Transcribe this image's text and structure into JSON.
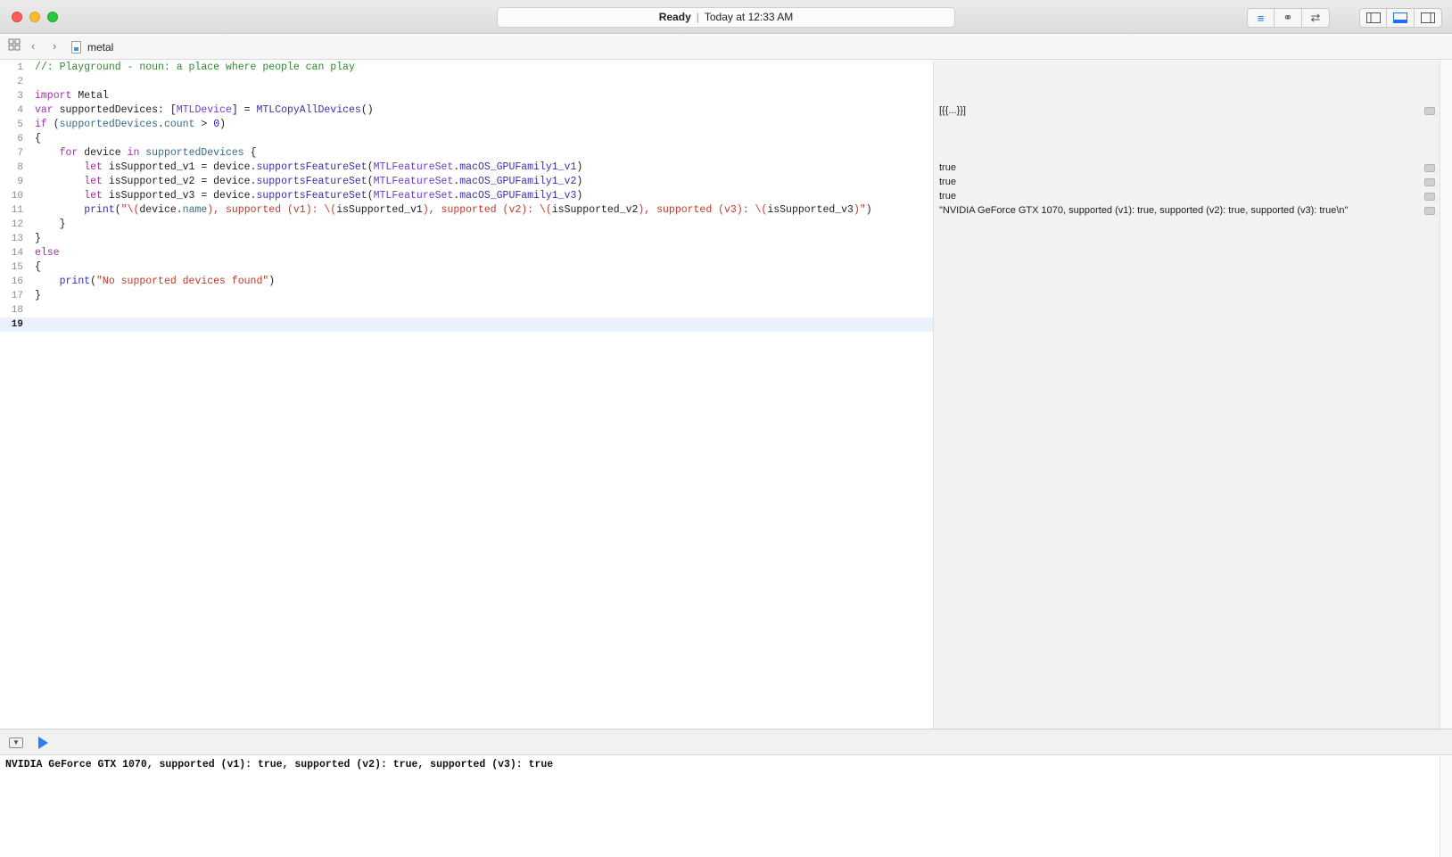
{
  "window": {
    "status": "Ready",
    "timestamp": "Today at 12:33 AM"
  },
  "toolbar": {
    "editor_buttons": [
      "standard-editor",
      "assistant-editor",
      "version-editor"
    ],
    "view_buttons": [
      "navigator",
      "debug-area",
      "utilities"
    ]
  },
  "jumpbar": {
    "file_name": "metal"
  },
  "editor": {
    "line_numbers": [
      "1",
      "2",
      "3",
      "4",
      "5",
      "6",
      "7",
      "8",
      "9",
      "10",
      "11",
      "12",
      "13",
      "14",
      "15",
      "16",
      "17",
      "18",
      "19"
    ],
    "current_line": "19"
  },
  "results": {
    "line4": "[{{...}}]",
    "line8": "true",
    "line9": "true",
    "line10": "true",
    "line11": "\"NVIDIA GeForce GTX 1070, supported (v1): true, supported (v2): true, supported (v3): true\\n\""
  },
  "console": {
    "output": "NVIDIA GeForce GTX 1070, supported (v1): true, supported (v2): true, supported (v3): true"
  }
}
